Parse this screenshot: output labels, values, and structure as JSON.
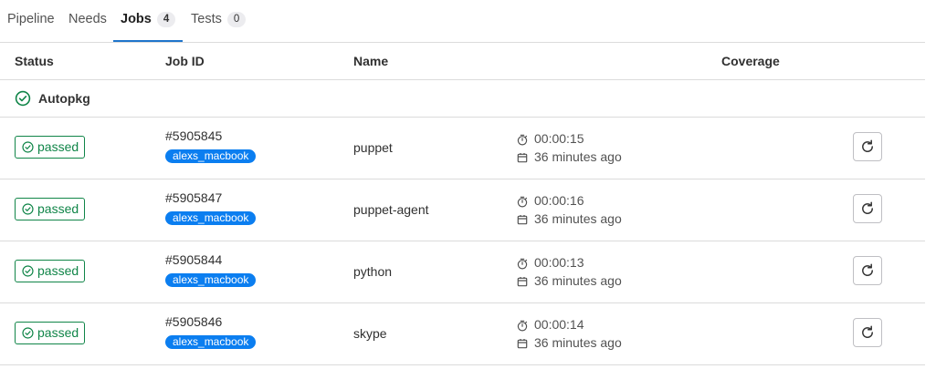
{
  "tabs": [
    {
      "label": "Pipeline"
    },
    {
      "label": "Needs"
    },
    {
      "label": "Jobs",
      "count": "4"
    },
    {
      "label": "Tests",
      "count": "0"
    }
  ],
  "table": {
    "headers": {
      "status": "Status",
      "job_id": "Job ID",
      "name": "Name",
      "coverage": "Coverage"
    },
    "stage": {
      "name": "Autopkg",
      "icon": "status-success-icon"
    },
    "jobs": [
      {
        "status": "passed",
        "id": "#5905845",
        "tag": "alexs_macbook",
        "name": "puppet",
        "duration": "00:00:15",
        "finished": "36 minutes ago"
      },
      {
        "status": "passed",
        "id": "#5905847",
        "tag": "alexs_macbook",
        "name": "puppet-agent",
        "duration": "00:00:16",
        "finished": "36 minutes ago"
      },
      {
        "status": "passed",
        "id": "#5905844",
        "tag": "alexs_macbook",
        "name": "python",
        "duration": "00:00:13",
        "finished": "36 minutes ago"
      },
      {
        "status": "passed",
        "id": "#5905846",
        "tag": "alexs_macbook",
        "name": "skype",
        "duration": "00:00:14",
        "finished": "36 minutes ago"
      }
    ]
  },
  "colors": {
    "success": "#108548",
    "tag": "#0b7ef0",
    "active_tab_underline": "#1f75cb"
  }
}
